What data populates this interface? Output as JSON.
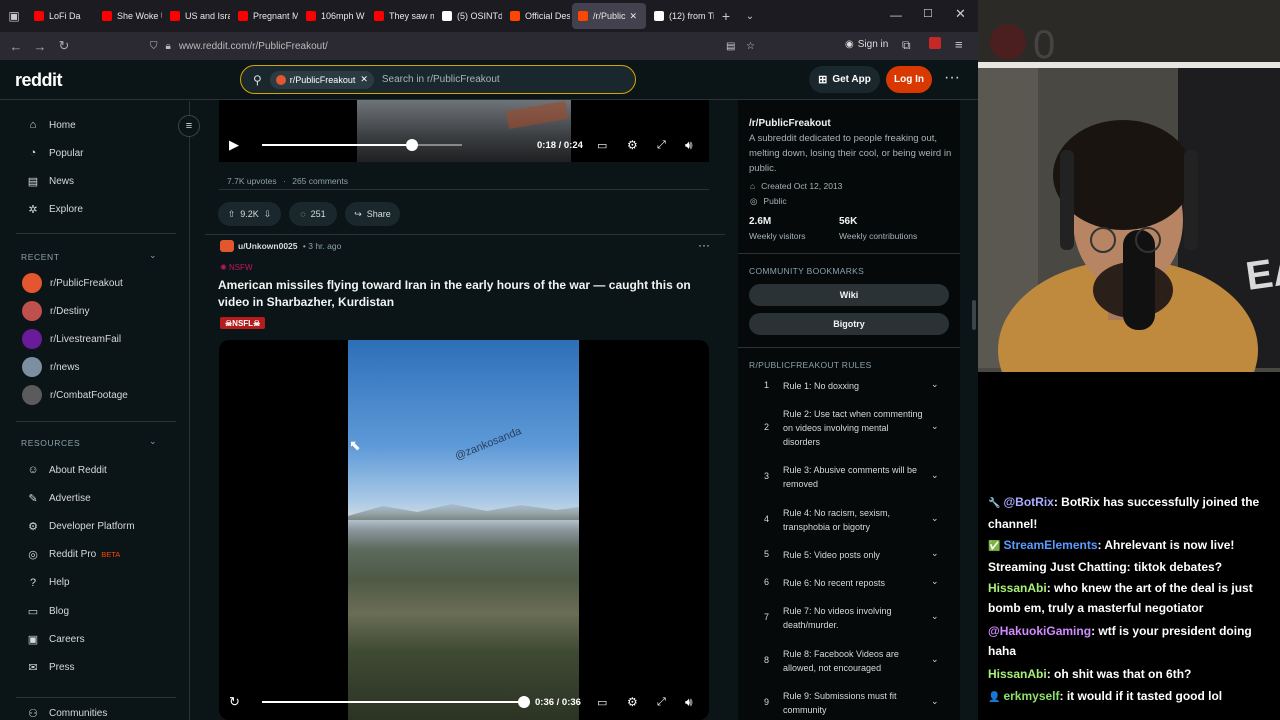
{
  "browser": {
    "tabs": [
      {
        "label": "LoFi Da",
        "color": "#ff0000"
      },
      {
        "label": "She Woke U",
        "color": "#ff0000"
      },
      {
        "label": "US and Isra",
        "color": "#ff0000"
      },
      {
        "label": "Pregnant M",
        "color": "#ff0000"
      },
      {
        "label": "106mph W",
        "color": "#ff0000"
      },
      {
        "label": "They saw m",
        "color": "#ff0000"
      },
      {
        "label": "(5) OSINTde",
        "color": "#ffffff"
      },
      {
        "label": "Official Des",
        "color": "#ff4500"
      },
      {
        "label": "/r/Public",
        "color": "#ff4500"
      },
      {
        "label": "(12) from Ti",
        "color": "#ffffff"
      }
    ],
    "url": "www.reddit.com/r/PublicFreakout/",
    "sign_in": "Sign in"
  },
  "header": {
    "logo": "reddit",
    "search_chip": "r/PublicFreakout",
    "search_placeholder": "Search in r/PublicFreakout",
    "get_app": "Get App",
    "login": "Log In"
  },
  "sidebar": {
    "main": [
      {
        "label": "Home",
        "icon": "home-icon",
        "glyph": "⌂"
      },
      {
        "label": "Popular",
        "icon": "popular-icon",
        "glyph": "◔"
      },
      {
        "label": "News",
        "icon": "news-icon",
        "glyph": "▤"
      },
      {
        "label": "Explore",
        "icon": "explore-icon",
        "glyph": "✲"
      }
    ],
    "recent_header": "RECENT",
    "recent": [
      {
        "label": "r/PublicFreakout",
        "color": "#e4572e"
      },
      {
        "label": "r/Destiny",
        "color": "#c0504d"
      },
      {
        "label": "r/LivestreamFail",
        "color": "#6a1b9a"
      },
      {
        "label": "r/news",
        "color": "#7c8fa0"
      },
      {
        "label": "r/CombatFootage",
        "color": "#5b5b5b"
      }
    ],
    "resources_header": "RESOURCES",
    "resources": [
      {
        "label": "About Reddit",
        "icon": "about-icon",
        "glyph": "☺"
      },
      {
        "label": "Advertise",
        "icon": "advertise-icon",
        "glyph": "✎"
      },
      {
        "label": "Developer Platform",
        "icon": "developer-icon",
        "glyph": "⚙"
      },
      {
        "label": "Reddit Pro",
        "icon": "reddit-pro-icon",
        "glyph": "◎"
      },
      {
        "label": "Help",
        "icon": "help-icon",
        "glyph": "?"
      },
      {
        "label": "Blog",
        "icon": "blog-icon",
        "glyph": "▭"
      },
      {
        "label": "Careers",
        "icon": "careers-icon",
        "glyph": "▣"
      },
      {
        "label": "Press",
        "icon": "press-icon",
        "glyph": "✉"
      }
    ],
    "reddit_pro_badge": "BETA",
    "communities": "Communities"
  },
  "post1": {
    "time": "0:18 / 0:24",
    "progress": 0.75,
    "upvotes_text": "7.7K upvotes",
    "comments_text": "265 comments",
    "votes": "9.2K",
    "comments": "251",
    "share": "Share"
  },
  "post2": {
    "author": "u/Unkown0025",
    "age": "• 3 hr. ago",
    "flair": "NSFW",
    "title": "American missiles flying toward Iran in the early hours of the war — caught this on video in Sharbazher, Kurdistan",
    "tag": "NSFL",
    "watermark": "@zankosanda",
    "time": "0:36 / 0:36",
    "progress": 1.0
  },
  "community": {
    "name": "/r/PublicFreakout",
    "description": "A subreddit dedicated to people freaking out, melting down, losing their cool, or being weird in public.",
    "created": "Created Oct 12, 2013",
    "visibility": "Public",
    "stat1_value": "2.6M",
    "stat1_label": "Weekly visitors",
    "stat2_value": "56K",
    "stat2_label": "Weekly contributions",
    "bookmarks_header": "COMMUNITY BOOKMARKS",
    "bookmarks": [
      "Wiki",
      "Bigotry"
    ],
    "rules_header": "R/PUBLICFREAKOUT RULES",
    "rules": [
      {
        "num": "1",
        "text": "Rule 1: No doxxing"
      },
      {
        "num": "2",
        "text": "Rule 2: Use tact when commenting on videos involving mental disorders"
      },
      {
        "num": "3",
        "text": "Rule 3: Abusive comments will be removed"
      },
      {
        "num": "4",
        "text": "Rule 4: No racism, sexism, transphobia or bigotry"
      },
      {
        "num": "5",
        "text": "Rule 5: Video posts only"
      },
      {
        "num": "6",
        "text": "Rule 6: No recent reposts"
      },
      {
        "num": "7",
        "text": "Rule 7: No videos involving death/murder."
      },
      {
        "num": "8",
        "text": "Rule 8: Facebook Videos are allowed, not encouraged"
      },
      {
        "num": "9",
        "text": "Rule 9: Submissions must fit community"
      }
    ]
  },
  "chat": [
    {
      "user": "@BotRix",
      "color": "#adadff",
      "badge": "🔧",
      "text": ": BotRix has successfully joined the channel!"
    },
    {
      "user": "StreamElements",
      "color": "#5b9bff",
      "badge": "✅",
      "text": ": Ahrelevant is now live! Streaming Just Chatting: tiktok debates?"
    },
    {
      "user": "HissanAbi",
      "color": "#a8f07a",
      "badge": "",
      "text": ": who knew the art of the deal is just bomb em, truly a masterful negotiator"
    },
    {
      "user": "@HakuokiGaming",
      "color": "#d28cff",
      "badge": "",
      "text": ": wtf is your president doing haha"
    },
    {
      "user": "HissanAbi",
      "color": "#a8f07a",
      "badge": "",
      "text": ": oh shit was that on 6th?"
    },
    {
      "user": "erkmyself",
      "color": "#8fe06b",
      "badge": "👤",
      "text": ": it would if it tasted good lol"
    }
  ]
}
